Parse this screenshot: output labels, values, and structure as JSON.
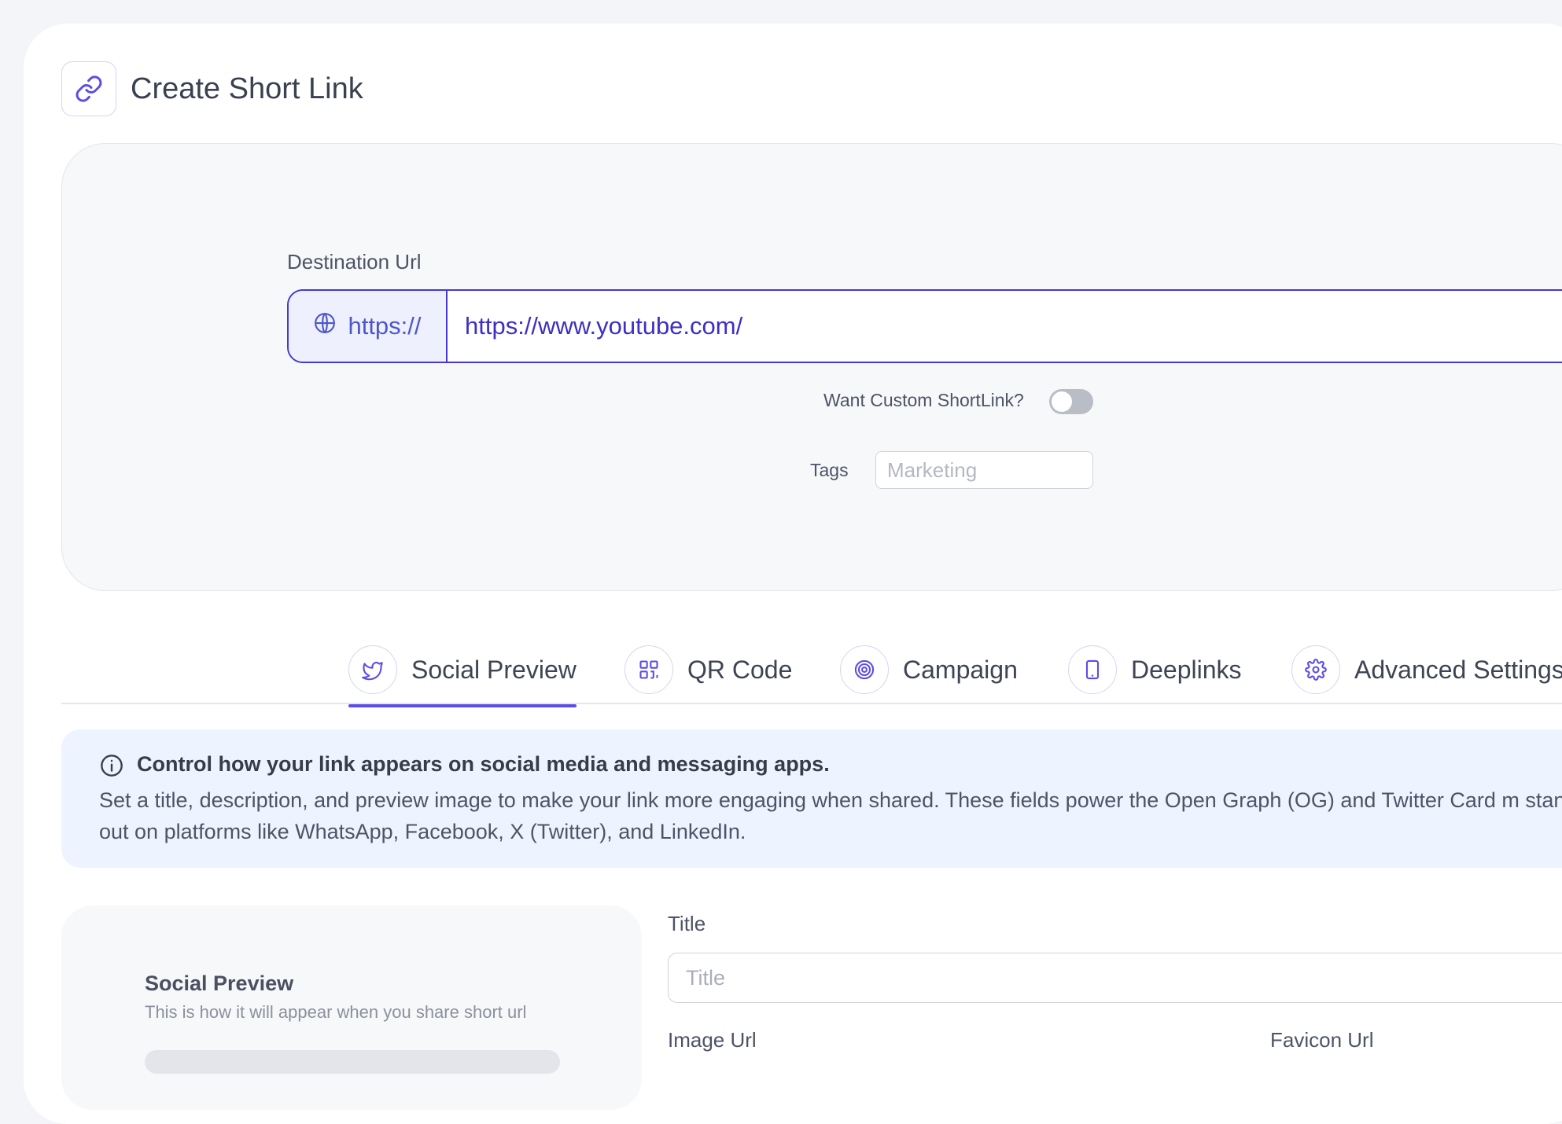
{
  "header": {
    "title": "Create Short Link",
    "icon": "link-icon"
  },
  "destination": {
    "label": "Destination Url",
    "prefix": "https://",
    "value": "https://www.youtube.com/"
  },
  "custom_shortlink": {
    "label": "Want Custom ShortLink?",
    "enabled": false
  },
  "tags": {
    "label": "Tags",
    "placeholder": "Marketing"
  },
  "tabs": [
    {
      "label": "Social Preview",
      "icon": "twitter-bird-icon",
      "active": true
    },
    {
      "label": "QR Code",
      "icon": "qr-code-icon",
      "active": false
    },
    {
      "label": "Campaign",
      "icon": "target-icon",
      "active": false
    },
    {
      "label": "Deeplinks",
      "icon": "mobile-phone-icon",
      "active": false
    },
    {
      "label": "Advanced Settings",
      "icon": "gear-icon",
      "active": false
    }
  ],
  "info": {
    "heading": "Control how your link appears on social media and messaging apps.",
    "body": "Set a title, description, and preview image to make your link more engaging when shared. These fields power the Open Graph (OG) and Twitter Card m stand out on platforms like WhatsApp, Facebook, X (Twitter), and LinkedIn."
  },
  "preview": {
    "title": "Social Preview",
    "subtitle": "This is how it will appear when you share short url"
  },
  "form": {
    "title_label": "Title",
    "title_placeholder": "Title",
    "image_url_label": "Image Url",
    "favicon_url_label": "Favicon Url"
  },
  "colors": {
    "accent": "#4638d6",
    "tab_underline": "#5b4de8",
    "info_background": "#eef4ff"
  }
}
